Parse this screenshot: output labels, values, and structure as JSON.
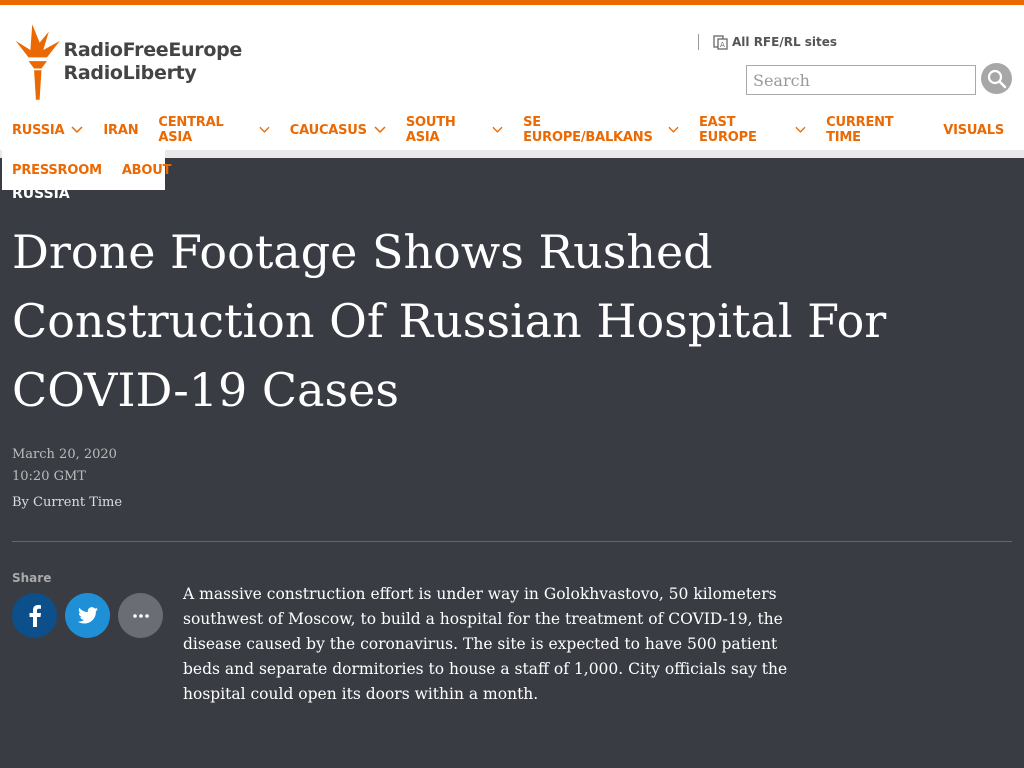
{
  "header": {
    "logo_line1": "RadioFreeEurope",
    "logo_line2": "RadioLiberty",
    "all_sites": "All RFE/RL sites",
    "search_placeholder": "Search"
  },
  "nav": {
    "items": [
      {
        "label": "RUSSIA",
        "has_dropdown": true
      },
      {
        "label": "IRAN",
        "has_dropdown": false
      },
      {
        "label": "CENTRAL ASIA",
        "has_dropdown": true
      },
      {
        "label": "CAUCASUS",
        "has_dropdown": true
      },
      {
        "label": "SOUTH ASIA",
        "has_dropdown": true
      },
      {
        "label": "SE EUROPE/BALKANS",
        "has_dropdown": true
      },
      {
        "label": "EAST EUROPE",
        "has_dropdown": true
      },
      {
        "label": "CURRENT TIME",
        "has_dropdown": false
      },
      {
        "label": "VISUALS",
        "has_dropdown": false
      }
    ],
    "row2": [
      {
        "label": "PRESSROOM"
      },
      {
        "label": "ABOUT"
      }
    ]
  },
  "article": {
    "section": "RUSSIA",
    "title": "Drone Footage Shows Rushed Construction Of Russian Hospital For COVID-19 Cases",
    "date": "March 20, 2020",
    "time": "10:20 GMT",
    "byline": "By Current Time",
    "share_label": "Share",
    "body": "A massive construction effort is under way in Golokhvastovo, 50 kilometers southwest of Moscow, to build a hospital for the treatment of COVID-19, the disease caused by the coronavirus. The site is expected to have 500 patient beds and separate dormitories to house a staff of 1,000. City officials say the hospital could open its doors within a month."
  },
  "colors": {
    "brand_orange": "#ea6903",
    "page_bg": "#393c43",
    "facebook": "#0d4f8a",
    "twitter": "#1f8fd8"
  }
}
